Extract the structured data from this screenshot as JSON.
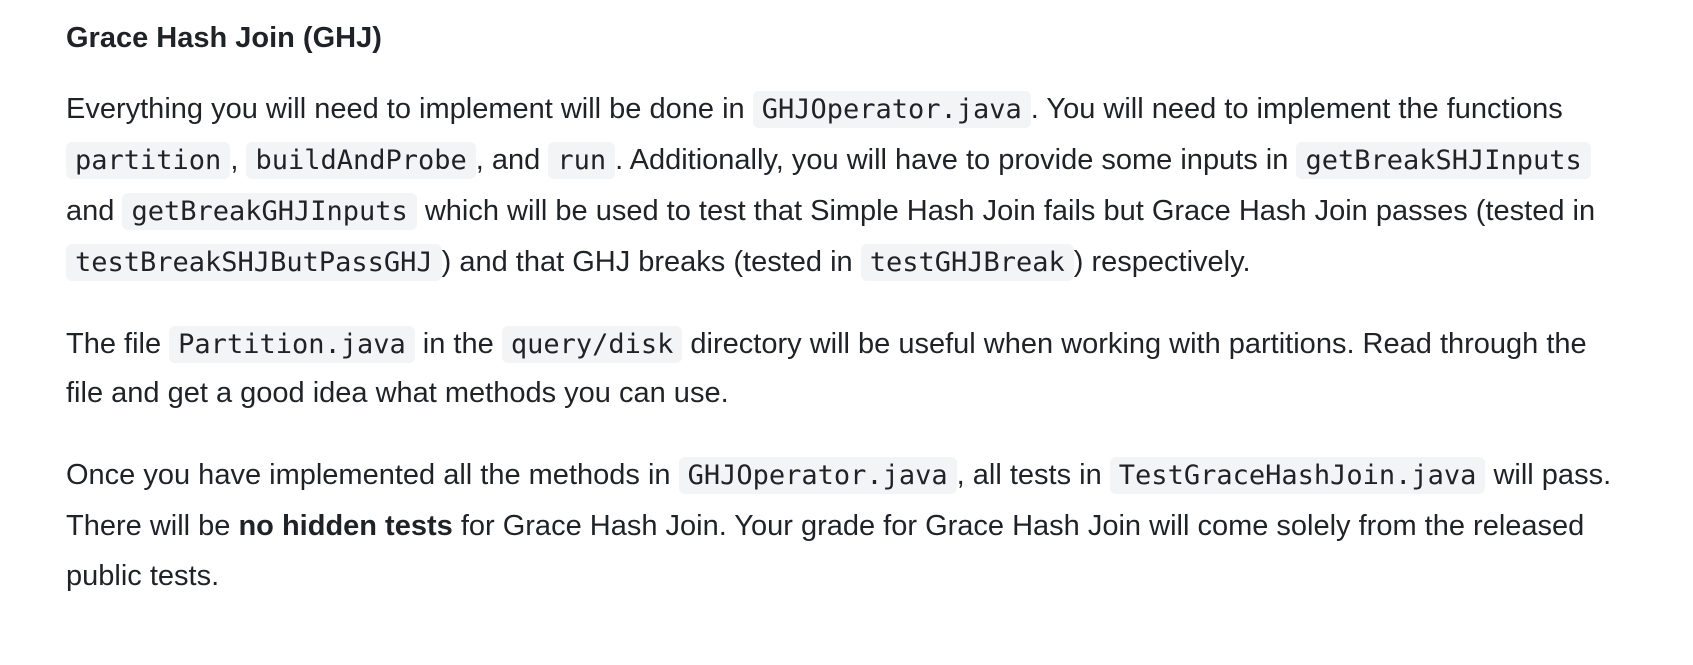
{
  "heading": "Grace Hash Join (GHJ)",
  "para1": {
    "t1": "Everything you will need to implement will be done in ",
    "c1": "GHJOperator.java",
    "t2": ". You will need to implement the functions ",
    "c2": "partition",
    "t3": ", ",
    "c3": "buildAndProbe",
    "t4": ", and ",
    "c4": "run",
    "t5": ". Additionally, you will have to provide some inputs in ",
    "c5": "getBreakSHJInputs",
    "t6": " and ",
    "c6": "getBreakGHJInputs",
    "t7": " which will be used to test that Simple Hash Join fails but Grace Hash Join passes (tested in ",
    "c7": "testBreakSHJButPassGHJ",
    "t8": ") and that GHJ breaks (tested in ",
    "c8": "testGHJBreak",
    "t9": ") respectively."
  },
  "para2": {
    "t1": "The file ",
    "c1": "Partition.java",
    "t2": " in the ",
    "c2": "query/disk",
    "t3": " directory will be useful when working with partitions. Read through the file and get a good idea what methods you can use."
  },
  "para3": {
    "t1": "Once you have implemented all the methods in ",
    "c1": "GHJOperator.java",
    "t2": ", all tests in ",
    "c2": "TestGraceHashJoin.java",
    "t3": " will pass. There will be ",
    "b1": "no hidden tests",
    "t4": " for Grace Hash Join. Your grade for Grace Hash Join will come solely from the released public tests."
  }
}
